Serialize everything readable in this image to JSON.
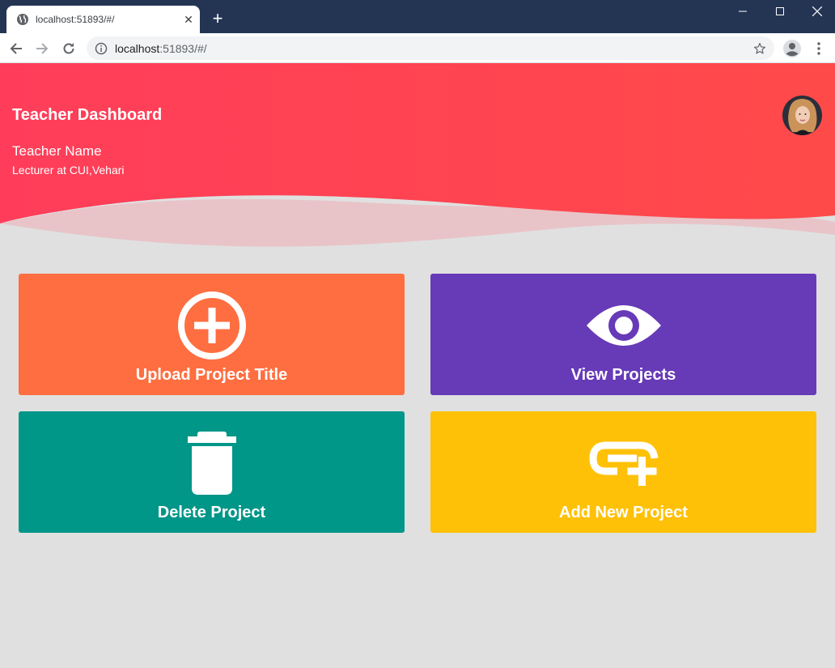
{
  "browser": {
    "tab_title": "localhost:51893/#/",
    "url_host": "localhost",
    "url_rest": ":51893/#/",
    "icons": [
      "globe-icon",
      "close-icon",
      "plus-icon",
      "back-arrow-icon",
      "forward-arrow-icon",
      "reload-icon",
      "info-icon",
      "star-icon",
      "profile-icon",
      "menu-dots-icon",
      "minimize-icon",
      "maximize-icon",
      "window-close-icon"
    ]
  },
  "header": {
    "title": "Teacher Dashboard",
    "teacher_name": "Teacher Name",
    "teacher_role": "Lecturer at CUI,Vehari",
    "gradient_start": "#ff3d5a",
    "gradient_end": "#ff4a4a"
  },
  "cards": [
    {
      "label": "Upload Project Title",
      "icon": "plus-circle-icon",
      "color": "#ff6e40"
    },
    {
      "label": "View Projects",
      "icon": "eye-icon",
      "color": "#673ab7"
    },
    {
      "label": "Delete Project",
      "icon": "trash-icon",
      "color": "#009688"
    },
    {
      "label": "Add New Project",
      "icon": "add-link-icon",
      "color": "#ffc107"
    }
  ]
}
